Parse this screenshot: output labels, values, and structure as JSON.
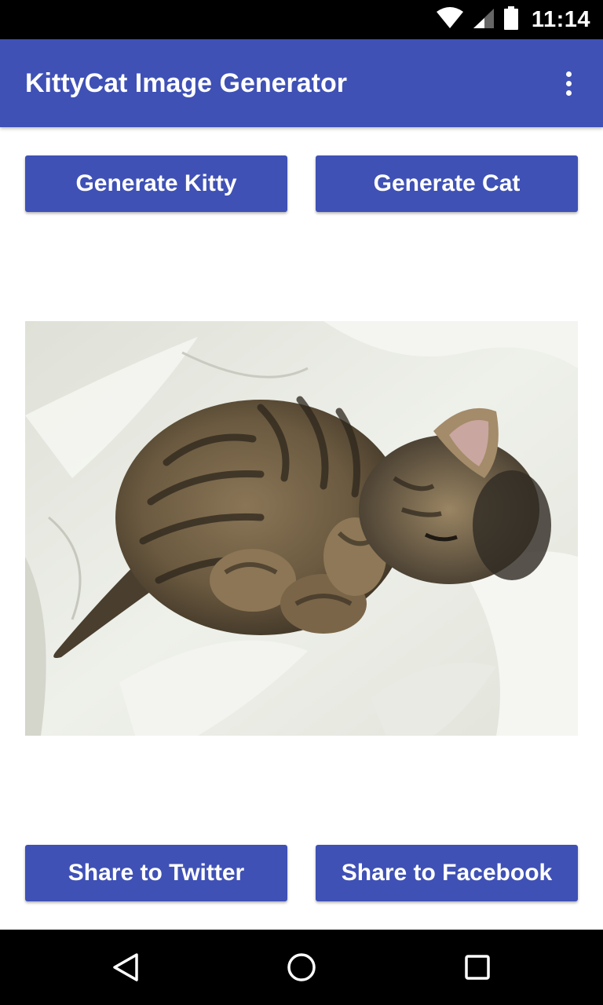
{
  "status_bar": {
    "time": "11:14",
    "icons": [
      "wifi-icon",
      "cell-signal-icon",
      "battery-icon"
    ]
  },
  "app_bar": {
    "title": "KittyCat Image Generator",
    "menu_icon": "more-vert-icon",
    "color": "#3f51b5"
  },
  "actions": {
    "generate_kitty": "Generate Kitty",
    "generate_cat": "Generate Cat"
  },
  "image": {
    "subject": "sleeping tabby kitten on white sheets"
  },
  "share": {
    "twitter": "Share to Twitter",
    "facebook": "Share to Facebook"
  },
  "nav_bar": {
    "icons": [
      "back-icon",
      "home-icon",
      "recents-icon"
    ]
  },
  "colors": {
    "primary": "#3f51b5",
    "background": "#ffffff",
    "system_bars": "#000000"
  }
}
